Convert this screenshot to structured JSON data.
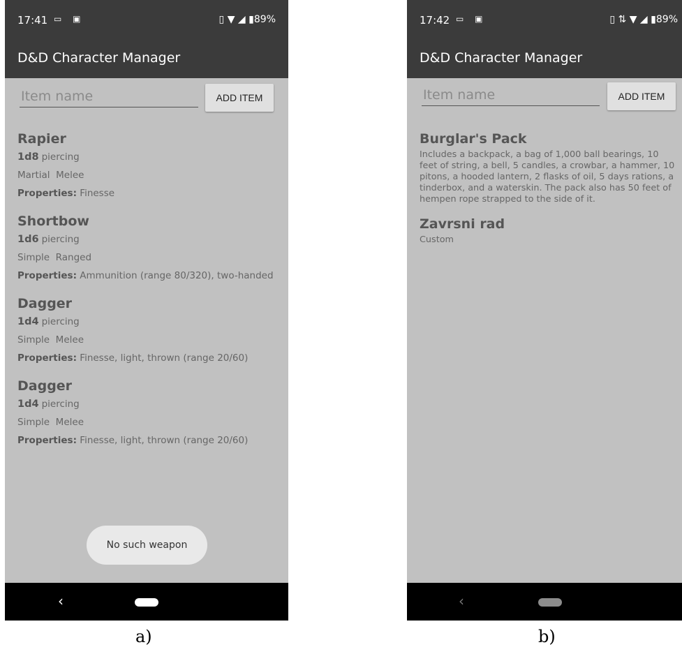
{
  "app_title": "D&D Character Manager",
  "input_placeholder": "Item name",
  "add_button_label": "ADD ITEM",
  "screen_a": {
    "status_time": "17:41",
    "battery": "89%",
    "items": [
      {
        "name": "Rapier",
        "damage": "1d8",
        "damage_type": "piercing",
        "category": "Martial  Melee",
        "props_label": "Properties:",
        "props": "Finesse"
      },
      {
        "name": "Shortbow",
        "damage": "1d6",
        "damage_type": "piercing",
        "category": "Simple  Ranged",
        "props_label": "Properties:",
        "props": "Ammunition (range 80/320), two-handed"
      },
      {
        "name": "Dagger",
        "damage": "1d4",
        "damage_type": "piercing",
        "category": "Simple  Melee",
        "props_label": "Properties:",
        "props": "Finesse, light, thrown (range 20/60)"
      },
      {
        "name": "Dagger",
        "damage": "1d4",
        "damage_type": "piercing",
        "category": "Simple  Melee",
        "props_label": "Properties:",
        "props": "Finesse, light, thrown (range 20/60)"
      }
    ],
    "toast": "No such weapon",
    "caption": "a)"
  },
  "screen_b": {
    "status_time": "17:42",
    "battery": "89%",
    "items": [
      {
        "name": "Burglar's Pack",
        "description": "Includes a backpack, a bag of 1,000 ball bearings, 10 feet of string, a bell, 5 candles, a crowbar, a hammer, 10 pitons, a hooded lantern, 2 flasks of oil, 5 days rations, a tinderbox, and a waterskin. The pack also has 50 feet of hempen rope strapped to the side of it."
      },
      {
        "name": "Zavrsni rad",
        "description": "Custom"
      }
    ],
    "caption": "b)"
  }
}
